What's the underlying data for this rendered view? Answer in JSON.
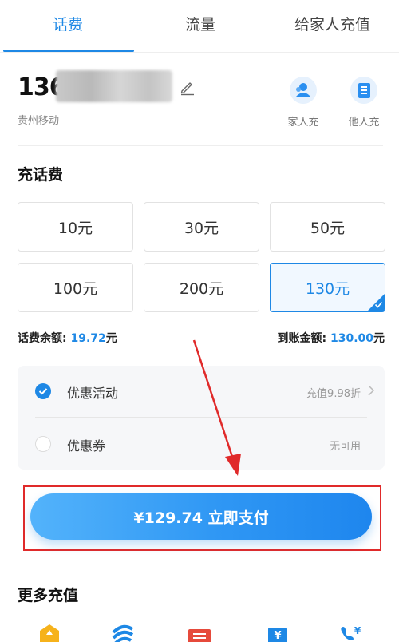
{
  "tabs": [
    {
      "label": "话费",
      "active": true
    },
    {
      "label": "流量",
      "active": false
    },
    {
      "label": "给家人充值",
      "active": false
    }
  ],
  "phone": {
    "prefix": "136",
    "carrier": "贵州移动"
  },
  "quick_actions": [
    {
      "label": "家人充",
      "icon": "family-icon"
    },
    {
      "label": "他人充",
      "icon": "contact-book-icon"
    }
  ],
  "recharge": {
    "title": "充话费",
    "amounts": [
      {
        "label": "10元",
        "selected": false
      },
      {
        "label": "30元",
        "selected": false
      },
      {
        "label": "50元",
        "selected": false
      },
      {
        "label": "100元",
        "selected": false
      },
      {
        "label": "200元",
        "selected": false
      },
      {
        "label": "130元",
        "selected": true
      }
    ]
  },
  "balance": {
    "label": "话费余额: ",
    "value": "19.72",
    "unit": "元"
  },
  "arrival": {
    "label": "到账金额: ",
    "value": "130.00",
    "unit": "元"
  },
  "promotions": [
    {
      "label": "优惠活动",
      "value": "充值9.98折",
      "checked": true
    },
    {
      "label": "优惠券",
      "value": "无可用",
      "checked": false
    }
  ],
  "pay_button": {
    "label": "¥129.74 立即支付"
  },
  "more": {
    "title": "更多充值",
    "icons": [
      "hexagon-icon",
      "wave-icon",
      "card-icon",
      "yuan-icon",
      "phone-yuan-icon"
    ]
  },
  "colors": {
    "accent": "#1e88e5",
    "highlight_frame": "#e02a2a"
  }
}
